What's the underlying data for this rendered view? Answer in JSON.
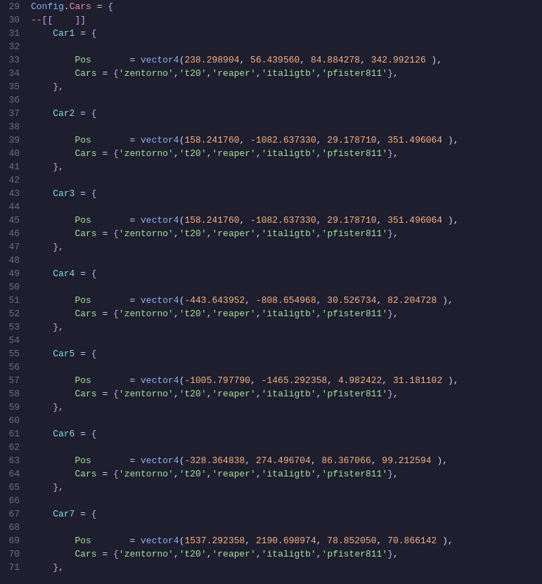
{
  "lines": [
    {
      "num": 29,
      "tokens": [
        {
          "t": "Config",
          "c": "kw-config"
        },
        {
          "t": ".",
          "c": "kw-punc"
        },
        {
          "t": "Cars",
          "c": "kw-cars-key"
        },
        {
          "t": " = ",
          "c": "kw-punc"
        },
        {
          "t": "{",
          "c": "kw-bracket"
        }
      ]
    },
    {
      "num": 30,
      "tokens": [
        {
          "t": "--",
          "c": "kw-dash"
        },
        {
          "t": "[[",
          "c": "kw-bracket"
        },
        {
          "t": "    ",
          "c": ""
        },
        {
          "t": "]]",
          "c": "kw-bracket"
        }
      ]
    },
    {
      "num": 31,
      "tokens": [
        {
          "t": "    ",
          "c": ""
        },
        {
          "t": "Car1",
          "c": "kw-carN"
        },
        {
          "t": " = ",
          "c": "kw-punc"
        },
        {
          "t": "{",
          "c": "kw-bracket"
        }
      ]
    },
    {
      "num": 32,
      "tokens": []
    },
    {
      "num": 33,
      "tokens": [
        {
          "t": "        ",
          "c": ""
        },
        {
          "t": "Pos",
          "c": "kw-pos"
        },
        {
          "t": "       = ",
          "c": "kw-punc"
        },
        {
          "t": "vector4",
          "c": "kw-vector"
        },
        {
          "t": "(",
          "c": "kw-punc"
        },
        {
          "t": "238.298904",
          "c": "kw-number"
        },
        {
          "t": ", ",
          "c": "kw-punc"
        },
        {
          "t": "56.439560",
          "c": "kw-number"
        },
        {
          "t": ", ",
          "c": "kw-punc"
        },
        {
          "t": "84.884278",
          "c": "kw-number"
        },
        {
          "t": ", ",
          "c": "kw-punc"
        },
        {
          "t": "342.992126",
          "c": "kw-number"
        },
        {
          "t": " ),",
          "c": "kw-punc"
        }
      ]
    },
    {
      "num": 34,
      "tokens": [
        {
          "t": "        ",
          "c": ""
        },
        {
          "t": "Cars",
          "c": "kw-cars-label"
        },
        {
          "t": " = ",
          "c": "kw-punc"
        },
        {
          "t": "{",
          "c": "kw-bracket"
        },
        {
          "t": "'zentorno'",
          "c": "kw-string"
        },
        {
          "t": ",",
          "c": "kw-punc"
        },
        {
          "t": "'t20'",
          "c": "kw-string"
        },
        {
          "t": ",",
          "c": "kw-punc"
        },
        {
          "t": "'reaper'",
          "c": "kw-string"
        },
        {
          "t": ",",
          "c": "kw-punc"
        },
        {
          "t": "'italigtb'",
          "c": "kw-string"
        },
        {
          "t": ",",
          "c": "kw-punc"
        },
        {
          "t": "'pfister811'",
          "c": "kw-string"
        },
        {
          "t": "}",
          "c": "kw-bracket"
        },
        {
          "t": ",",
          "c": "kw-punc"
        }
      ]
    },
    {
      "num": 35,
      "tokens": [
        {
          "t": "    ",
          "c": ""
        },
        {
          "t": "},",
          "c": "kw-bracket"
        }
      ]
    },
    {
      "num": 36,
      "tokens": []
    },
    {
      "num": 37,
      "tokens": [
        {
          "t": "    ",
          "c": ""
        },
        {
          "t": "Car2",
          "c": "kw-carN"
        },
        {
          "t": " = ",
          "c": "kw-punc"
        },
        {
          "t": "{",
          "c": "kw-bracket"
        }
      ]
    },
    {
      "num": 38,
      "tokens": []
    },
    {
      "num": 39,
      "tokens": [
        {
          "t": "        ",
          "c": ""
        },
        {
          "t": "Pos",
          "c": "kw-pos"
        },
        {
          "t": "       = ",
          "c": "kw-punc"
        },
        {
          "t": "vector4",
          "c": "kw-vector"
        },
        {
          "t": "(",
          "c": "kw-punc"
        },
        {
          "t": "158.241760",
          "c": "kw-number"
        },
        {
          "t": ", ",
          "c": "kw-punc"
        },
        {
          "t": "-1082.637330",
          "c": "kw-number"
        },
        {
          "t": ", ",
          "c": "kw-punc"
        },
        {
          "t": "29.178710",
          "c": "kw-number"
        },
        {
          "t": ", ",
          "c": "kw-punc"
        },
        {
          "t": "351.496064",
          "c": "kw-number"
        },
        {
          "t": " ),",
          "c": "kw-punc"
        }
      ]
    },
    {
      "num": 40,
      "tokens": [
        {
          "t": "        ",
          "c": ""
        },
        {
          "t": "Cars",
          "c": "kw-cars-label"
        },
        {
          "t": " = ",
          "c": "kw-punc"
        },
        {
          "t": "{",
          "c": "kw-bracket"
        },
        {
          "t": "'zentorno'",
          "c": "kw-string"
        },
        {
          "t": ",",
          "c": "kw-punc"
        },
        {
          "t": "'t20'",
          "c": "kw-string"
        },
        {
          "t": ",",
          "c": "kw-punc"
        },
        {
          "t": "'reaper'",
          "c": "kw-string"
        },
        {
          "t": ",",
          "c": "kw-punc"
        },
        {
          "t": "'italigtb'",
          "c": "kw-string"
        },
        {
          "t": ",",
          "c": "kw-punc"
        },
        {
          "t": "'pfister811'",
          "c": "kw-string"
        },
        {
          "t": "}",
          "c": "kw-bracket"
        },
        {
          "t": ",",
          "c": "kw-punc"
        }
      ]
    },
    {
      "num": 41,
      "tokens": [
        {
          "t": "    ",
          "c": ""
        },
        {
          "t": "},",
          "c": "kw-bracket"
        }
      ]
    },
    {
      "num": 42,
      "tokens": []
    },
    {
      "num": 43,
      "tokens": [
        {
          "t": "    ",
          "c": ""
        },
        {
          "t": "Car3",
          "c": "kw-carN"
        },
        {
          "t": " = ",
          "c": "kw-punc"
        },
        {
          "t": "{",
          "c": "kw-bracket"
        }
      ]
    },
    {
      "num": 44,
      "tokens": []
    },
    {
      "num": 45,
      "tokens": [
        {
          "t": "        ",
          "c": ""
        },
        {
          "t": "Pos",
          "c": "kw-pos"
        },
        {
          "t": "       = ",
          "c": "kw-punc"
        },
        {
          "t": "vector4",
          "c": "kw-vector"
        },
        {
          "t": "(",
          "c": "kw-punc"
        },
        {
          "t": "158.241760",
          "c": "kw-number"
        },
        {
          "t": ", ",
          "c": "kw-punc"
        },
        {
          "t": "-1082.637330",
          "c": "kw-number"
        },
        {
          "t": ", ",
          "c": "kw-punc"
        },
        {
          "t": "29.178710",
          "c": "kw-number"
        },
        {
          "t": ", ",
          "c": "kw-punc"
        },
        {
          "t": "351.496064",
          "c": "kw-number"
        },
        {
          "t": " ),",
          "c": "kw-punc"
        }
      ]
    },
    {
      "num": 46,
      "tokens": [
        {
          "t": "        ",
          "c": ""
        },
        {
          "t": "Cars",
          "c": "kw-cars-label"
        },
        {
          "t": " = ",
          "c": "kw-punc"
        },
        {
          "t": "{",
          "c": "kw-bracket"
        },
        {
          "t": "'zentorno'",
          "c": "kw-string"
        },
        {
          "t": ",",
          "c": "kw-punc"
        },
        {
          "t": "'t20'",
          "c": "kw-string"
        },
        {
          "t": ",",
          "c": "kw-punc"
        },
        {
          "t": "'reaper'",
          "c": "kw-string"
        },
        {
          "t": ",",
          "c": "kw-punc"
        },
        {
          "t": "'italigtb'",
          "c": "kw-string"
        },
        {
          "t": ",",
          "c": "kw-punc"
        },
        {
          "t": "'pfister811'",
          "c": "kw-string"
        },
        {
          "t": "}",
          "c": "kw-bracket"
        },
        {
          "t": ",",
          "c": "kw-punc"
        }
      ]
    },
    {
      "num": 47,
      "tokens": [
        {
          "t": "    ",
          "c": ""
        },
        {
          "t": "},",
          "c": "kw-bracket"
        }
      ]
    },
    {
      "num": 48,
      "tokens": []
    },
    {
      "num": 49,
      "tokens": [
        {
          "t": "    ",
          "c": ""
        },
        {
          "t": "Car4",
          "c": "kw-carN"
        },
        {
          "t": " = ",
          "c": "kw-punc"
        },
        {
          "t": "{",
          "c": "kw-bracket"
        }
      ]
    },
    {
      "num": 50,
      "tokens": []
    },
    {
      "num": 51,
      "tokens": [
        {
          "t": "        ",
          "c": ""
        },
        {
          "t": "Pos",
          "c": "kw-pos"
        },
        {
          "t": "       = ",
          "c": "kw-punc"
        },
        {
          "t": "vector4",
          "c": "kw-vector"
        },
        {
          "t": "(",
          "c": "kw-punc"
        },
        {
          "t": "-443.643952",
          "c": "kw-number"
        },
        {
          "t": ", ",
          "c": "kw-punc"
        },
        {
          "t": "-808.654968",
          "c": "kw-number"
        },
        {
          "t": ", ",
          "c": "kw-punc"
        },
        {
          "t": "30.526734",
          "c": "kw-number"
        },
        {
          "t": ", ",
          "c": "kw-punc"
        },
        {
          "t": "82.204728",
          "c": "kw-number"
        },
        {
          "t": " ),",
          "c": "kw-punc"
        }
      ]
    },
    {
      "num": 52,
      "tokens": [
        {
          "t": "        ",
          "c": ""
        },
        {
          "t": "Cars",
          "c": "kw-cars-label"
        },
        {
          "t": " = ",
          "c": "kw-punc"
        },
        {
          "t": "{",
          "c": "kw-bracket"
        },
        {
          "t": "'zentorno'",
          "c": "kw-string"
        },
        {
          "t": ",",
          "c": "kw-punc"
        },
        {
          "t": "'t20'",
          "c": "kw-string"
        },
        {
          "t": ",",
          "c": "kw-punc"
        },
        {
          "t": "'reaper'",
          "c": "kw-string"
        },
        {
          "t": ",",
          "c": "kw-punc"
        },
        {
          "t": "'italigtb'",
          "c": "kw-string"
        },
        {
          "t": ",",
          "c": "kw-punc"
        },
        {
          "t": "'pfister811'",
          "c": "kw-string"
        },
        {
          "t": "}",
          "c": "kw-bracket"
        },
        {
          "t": ",",
          "c": "kw-punc"
        }
      ]
    },
    {
      "num": 53,
      "tokens": [
        {
          "t": "    ",
          "c": ""
        },
        {
          "t": "},",
          "c": "kw-bracket"
        }
      ]
    },
    {
      "num": 54,
      "tokens": []
    },
    {
      "num": 55,
      "tokens": [
        {
          "t": "    ",
          "c": ""
        },
        {
          "t": "Car5",
          "c": "kw-carN"
        },
        {
          "t": " = ",
          "c": "kw-punc"
        },
        {
          "t": "{",
          "c": "kw-bracket"
        }
      ]
    },
    {
      "num": 56,
      "tokens": []
    },
    {
      "num": 57,
      "tokens": [
        {
          "t": "        ",
          "c": ""
        },
        {
          "t": "Pos",
          "c": "kw-pos"
        },
        {
          "t": "       = ",
          "c": "kw-punc"
        },
        {
          "t": "vector4",
          "c": "kw-vector"
        },
        {
          "t": "(",
          "c": "kw-punc"
        },
        {
          "t": "-1005.797790",
          "c": "kw-number"
        },
        {
          "t": ", ",
          "c": "kw-punc"
        },
        {
          "t": "-1465.292358",
          "c": "kw-number"
        },
        {
          "t": ", ",
          "c": "kw-punc"
        },
        {
          "t": "4.982422",
          "c": "kw-number"
        },
        {
          "t": ", ",
          "c": "kw-punc"
        },
        {
          "t": "31.181102",
          "c": "kw-number"
        },
        {
          "t": " ),",
          "c": "kw-punc"
        }
      ]
    },
    {
      "num": 58,
      "tokens": [
        {
          "t": "        ",
          "c": ""
        },
        {
          "t": "Cars",
          "c": "kw-cars-label"
        },
        {
          "t": " = ",
          "c": "kw-punc"
        },
        {
          "t": "{",
          "c": "kw-bracket"
        },
        {
          "t": "'zentorno'",
          "c": "kw-string"
        },
        {
          "t": ",",
          "c": "kw-punc"
        },
        {
          "t": "'t20'",
          "c": "kw-string"
        },
        {
          "t": ",",
          "c": "kw-punc"
        },
        {
          "t": "'reaper'",
          "c": "kw-string"
        },
        {
          "t": ",",
          "c": "kw-punc"
        },
        {
          "t": "'italigtb'",
          "c": "kw-string"
        },
        {
          "t": ",",
          "c": "kw-punc"
        },
        {
          "t": "'pfister811'",
          "c": "kw-string"
        },
        {
          "t": "}",
          "c": "kw-bracket"
        },
        {
          "t": ",",
          "c": "kw-punc"
        }
      ]
    },
    {
      "num": 59,
      "tokens": [
        {
          "t": "    ",
          "c": ""
        },
        {
          "t": "},",
          "c": "kw-bracket"
        }
      ]
    },
    {
      "num": 60,
      "tokens": []
    },
    {
      "num": 61,
      "tokens": [
        {
          "t": "    ",
          "c": ""
        },
        {
          "t": "Car6",
          "c": "kw-carN"
        },
        {
          "t": " = ",
          "c": "kw-punc"
        },
        {
          "t": "{",
          "c": "kw-bracket"
        }
      ]
    },
    {
      "num": 62,
      "tokens": []
    },
    {
      "num": 63,
      "tokens": [
        {
          "t": "        ",
          "c": ""
        },
        {
          "t": "Pos",
          "c": "kw-pos"
        },
        {
          "t": "       = ",
          "c": "kw-punc"
        },
        {
          "t": "vector4",
          "c": "kw-vector"
        },
        {
          "t": "(",
          "c": "kw-punc"
        },
        {
          "t": "-328.364838",
          "c": "kw-number"
        },
        {
          "t": ", ",
          "c": "kw-punc"
        },
        {
          "t": "274.496704",
          "c": "kw-number"
        },
        {
          "t": ", ",
          "c": "kw-punc"
        },
        {
          "t": "86.367066",
          "c": "kw-number"
        },
        {
          "t": ", ",
          "c": "kw-punc"
        },
        {
          "t": "99.212594",
          "c": "kw-number"
        },
        {
          "t": " ),",
          "c": "kw-punc"
        }
      ]
    },
    {
      "num": 64,
      "tokens": [
        {
          "t": "        ",
          "c": ""
        },
        {
          "t": "Cars",
          "c": "kw-cars-label"
        },
        {
          "t": " = ",
          "c": "kw-punc"
        },
        {
          "t": "{",
          "c": "kw-bracket"
        },
        {
          "t": "'zentorno'",
          "c": "kw-string"
        },
        {
          "t": ",",
          "c": "kw-punc"
        },
        {
          "t": "'t20'",
          "c": "kw-string"
        },
        {
          "t": ",",
          "c": "kw-punc"
        },
        {
          "t": "'reaper'",
          "c": "kw-string"
        },
        {
          "t": ",",
          "c": "kw-punc"
        },
        {
          "t": "'italigtb'",
          "c": "kw-string"
        },
        {
          "t": ",",
          "c": "kw-punc"
        },
        {
          "t": "'pfister811'",
          "c": "kw-string"
        },
        {
          "t": "}",
          "c": "kw-bracket"
        },
        {
          "t": ",",
          "c": "kw-punc"
        }
      ]
    },
    {
      "num": 65,
      "tokens": [
        {
          "t": "    ",
          "c": ""
        },
        {
          "t": "},",
          "c": "kw-bracket"
        }
      ]
    },
    {
      "num": 66,
      "tokens": []
    },
    {
      "num": 67,
      "tokens": [
        {
          "t": "    ",
          "c": ""
        },
        {
          "t": "Car7",
          "c": "kw-carN"
        },
        {
          "t": " = ",
          "c": "kw-punc"
        },
        {
          "t": "{",
          "c": "kw-bracket"
        }
      ]
    },
    {
      "num": 68,
      "tokens": []
    },
    {
      "num": 69,
      "tokens": [
        {
          "t": "        ",
          "c": ""
        },
        {
          "t": "Pos",
          "c": "kw-pos"
        },
        {
          "t": "       = ",
          "c": "kw-punc"
        },
        {
          "t": "vector4",
          "c": "kw-vector"
        },
        {
          "t": "(",
          "c": "kw-punc"
        },
        {
          "t": "1537.292358",
          "c": "kw-number"
        },
        {
          "t": ", ",
          "c": "kw-punc"
        },
        {
          "t": "2190.698974",
          "c": "kw-number"
        },
        {
          "t": ", ",
          "c": "kw-punc"
        },
        {
          "t": "78.852050",
          "c": "kw-number"
        },
        {
          "t": ", ",
          "c": "kw-punc"
        },
        {
          "t": "70.866142",
          "c": "kw-number"
        },
        {
          "t": " ),",
          "c": "kw-punc"
        }
      ]
    },
    {
      "num": 70,
      "tokens": [
        {
          "t": "        ",
          "c": ""
        },
        {
          "t": "Cars",
          "c": "kw-cars-label"
        },
        {
          "t": " = ",
          "c": "kw-punc"
        },
        {
          "t": "{",
          "c": "kw-bracket"
        },
        {
          "t": "'zentorno'",
          "c": "kw-string"
        },
        {
          "t": ",",
          "c": "kw-punc"
        },
        {
          "t": "'t20'",
          "c": "kw-string"
        },
        {
          "t": ",",
          "c": "kw-punc"
        },
        {
          "t": "'reaper'",
          "c": "kw-string"
        },
        {
          "t": ",",
          "c": "kw-punc"
        },
        {
          "t": "'italigtb'",
          "c": "kw-string"
        },
        {
          "t": ",",
          "c": "kw-punc"
        },
        {
          "t": "'pfister811'",
          "c": "kw-string"
        },
        {
          "t": "}",
          "c": "kw-bracket"
        },
        {
          "t": ",",
          "c": "kw-punc"
        }
      ]
    },
    {
      "num": 71,
      "tokens": [
        {
          "t": "    ",
          "c": ""
        },
        {
          "t": "},",
          "c": "kw-bracket"
        }
      ]
    }
  ]
}
